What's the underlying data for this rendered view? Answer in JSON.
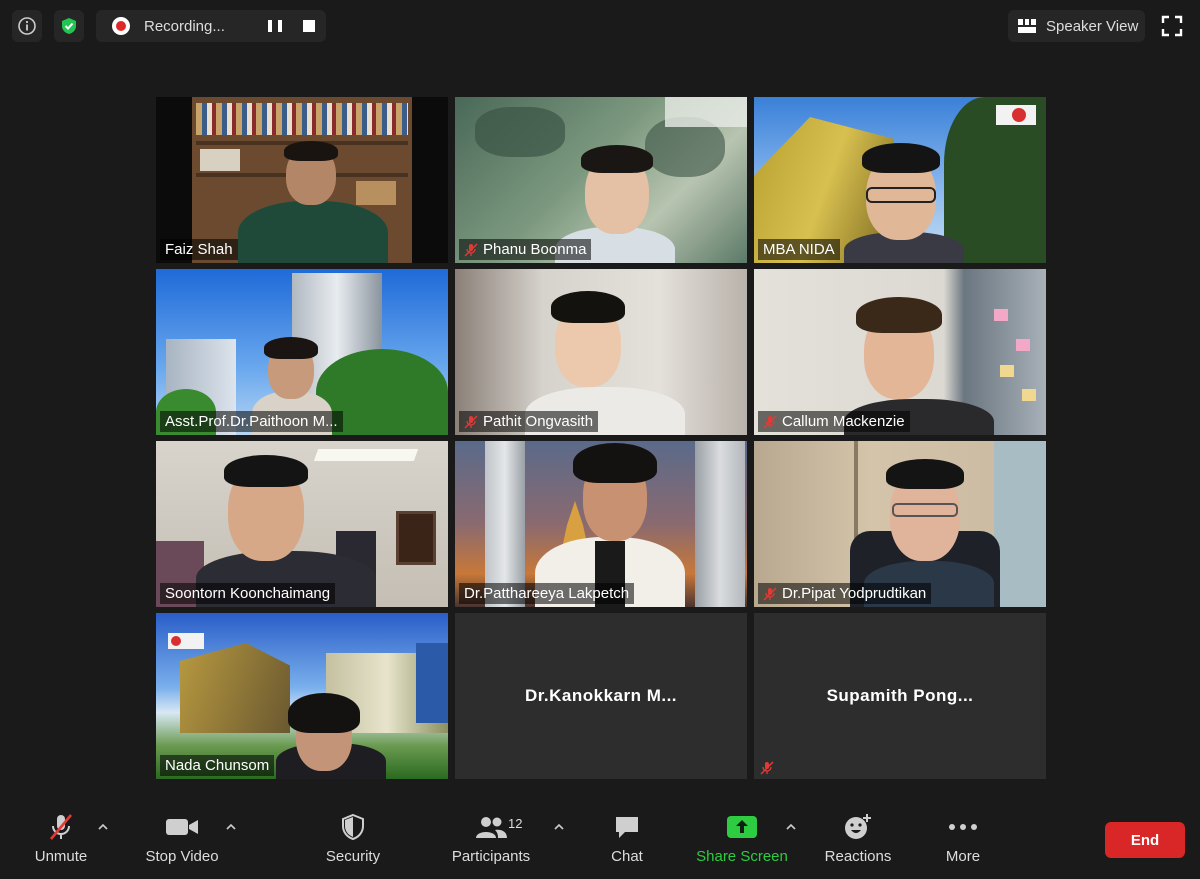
{
  "topbar": {
    "recording_label": "Recording...",
    "speaker_view_label": "Speaker View"
  },
  "participants": [
    {
      "name": "Faiz Shah",
      "muted": false
    },
    {
      "name": "Phanu Boonma",
      "muted": true
    },
    {
      "name": "MBA NIDA",
      "muted": false
    },
    {
      "name": "Asst.Prof.Dr.Paithoon M...",
      "muted": false
    },
    {
      "name": "Pathit Ongvasith",
      "muted": true
    },
    {
      "name": "Callum Mackenzie",
      "muted": true
    },
    {
      "name": "Soontorn Koonchaimang",
      "muted": false
    },
    {
      "name": "Dr.Patthareeya Lakpetch",
      "muted": false,
      "active_speaker": true
    },
    {
      "name": "Dr.Pipat Yodprudtikan",
      "muted": true
    },
    {
      "name": "Nada Chunsom",
      "muted": false
    },
    {
      "name": "Dr.Kanokkarn  M...",
      "muted": false,
      "video_off": true
    },
    {
      "name": "Supamith  Pong...",
      "muted": true,
      "video_off": true
    }
  ],
  "toolbar": {
    "unmute": "Unmute",
    "stop_video": "Stop Video",
    "security": "Security",
    "participants": "Participants",
    "participants_count": "12",
    "chat": "Chat",
    "share_screen": "Share Screen",
    "reactions": "Reactions",
    "more": "More",
    "end": "End"
  },
  "colors": {
    "background": "#1a1a1a",
    "active_speaker_border": "#c8d94c",
    "share_green": "#2ecc40",
    "end_red": "#d92626",
    "recording_red": "#e02828"
  }
}
